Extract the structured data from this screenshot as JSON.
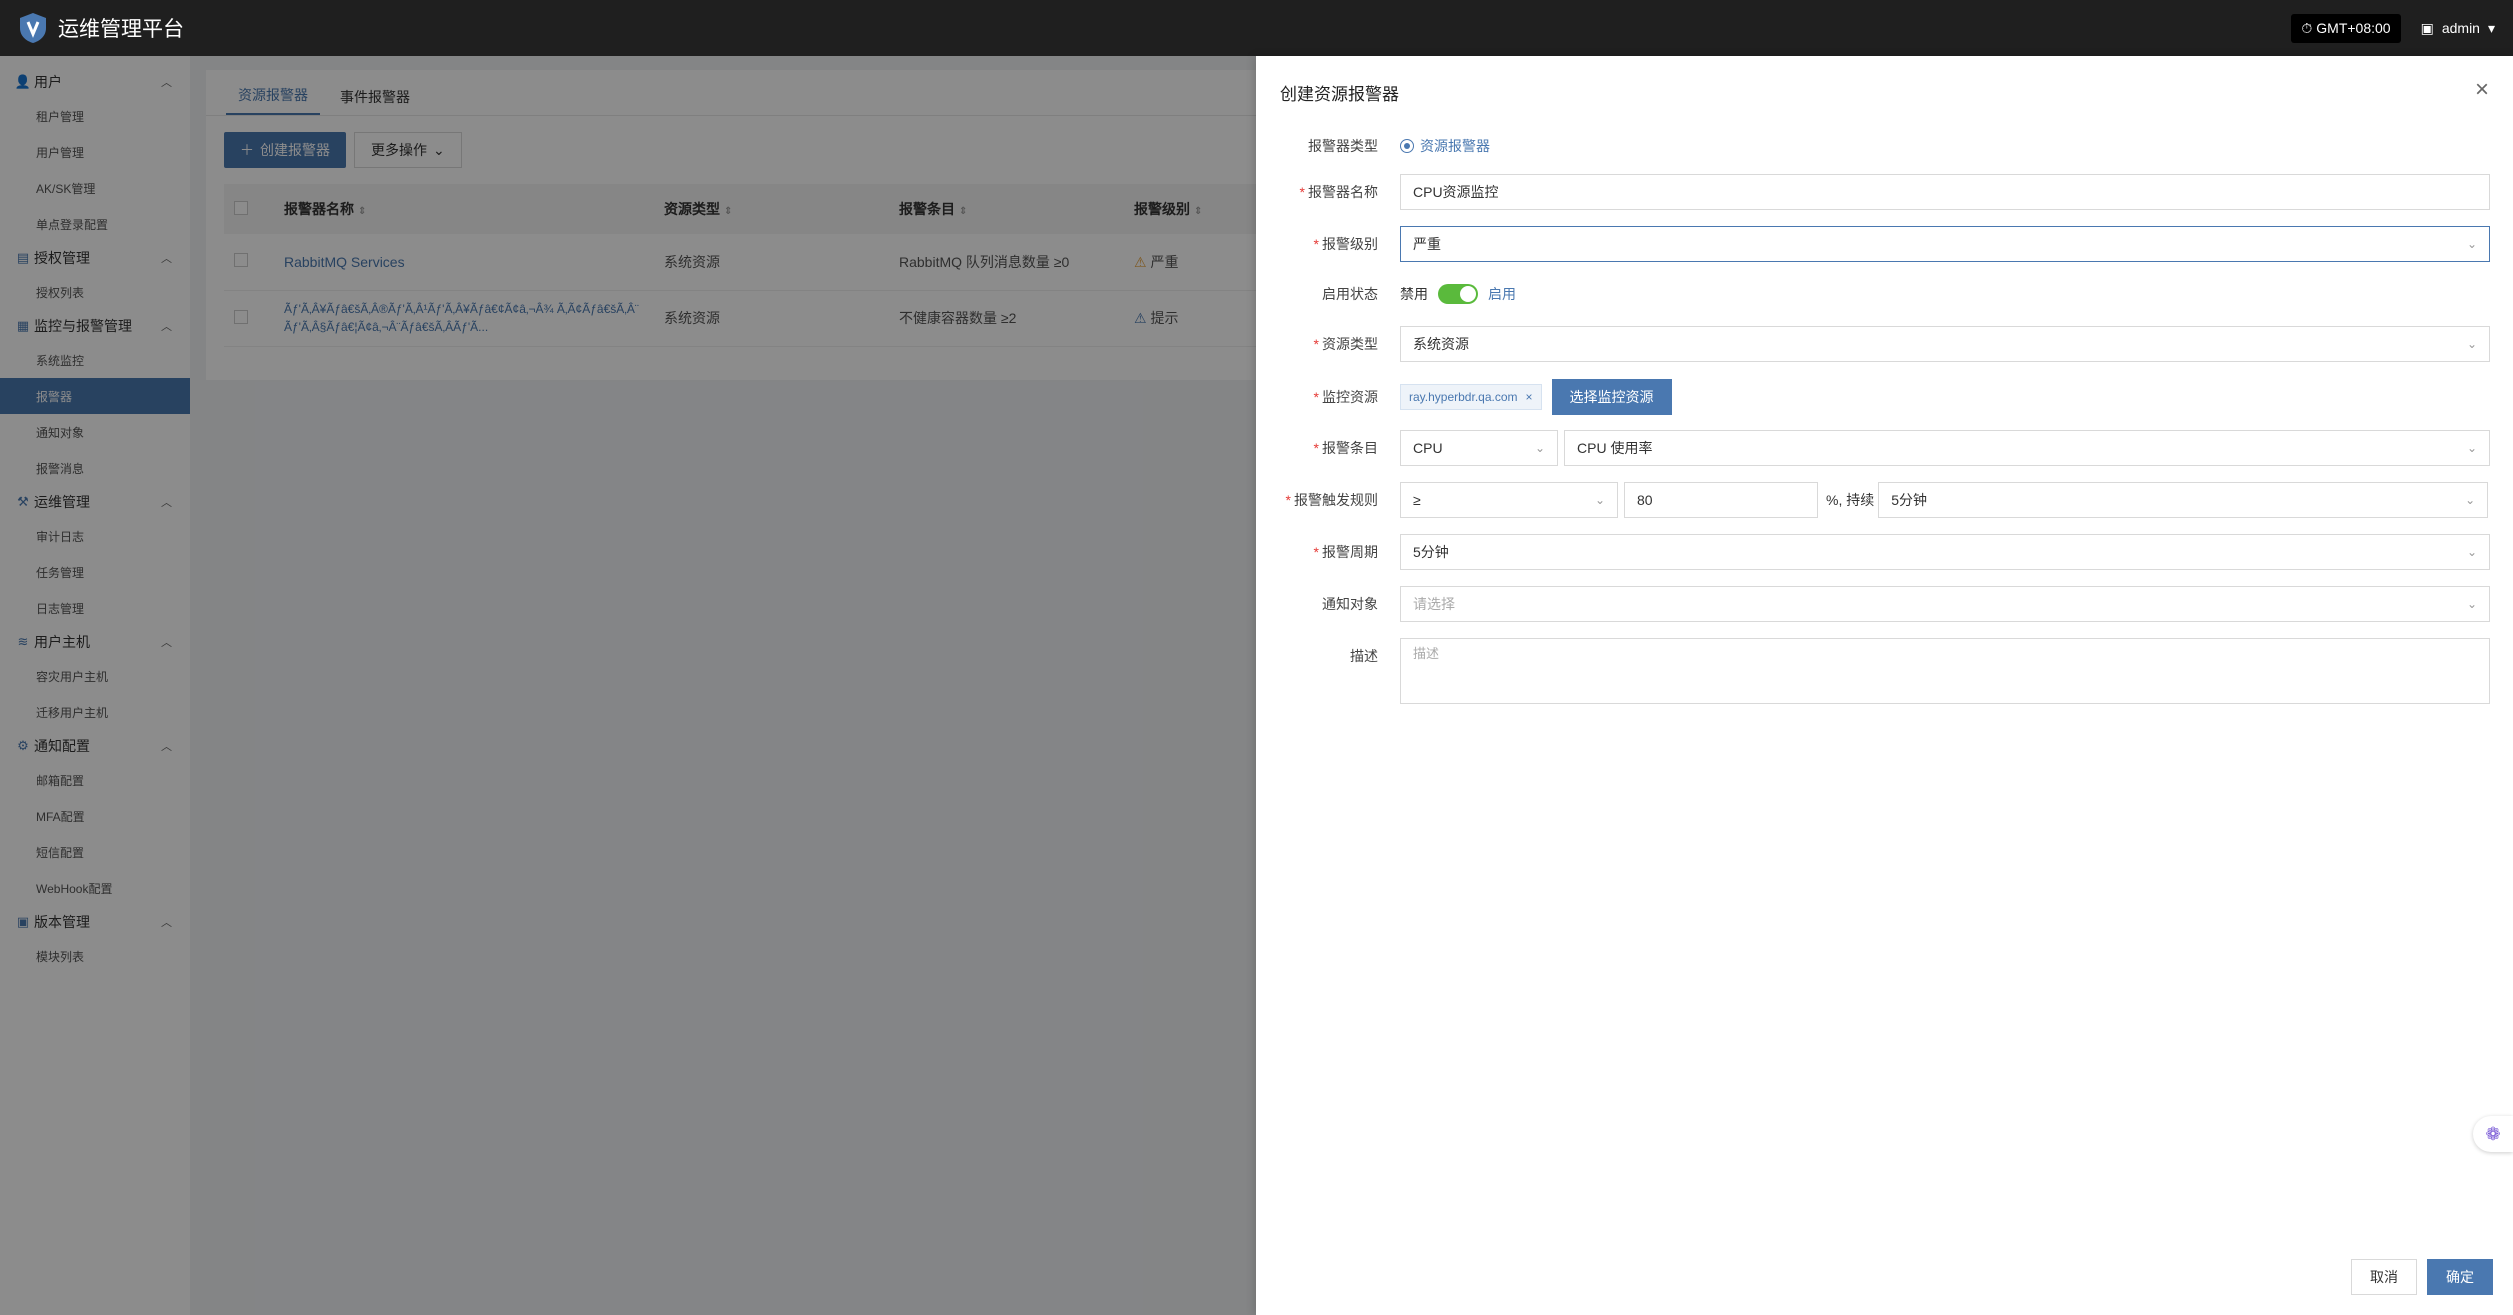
{
  "header": {
    "title": "运维管理平台",
    "timezone": "GMT+08:00",
    "user": "admin"
  },
  "sidebar": {
    "groups": [
      {
        "label": "用户",
        "icon": "user-icon",
        "items": [
          "租户管理",
          "用户管理",
          "AK/SK管理",
          "单点登录配置"
        ]
      },
      {
        "label": "授权管理",
        "icon": "license-icon",
        "items": [
          "授权列表"
        ]
      },
      {
        "label": "监控与报警管理",
        "icon": "monitor-icon",
        "items": [
          "系统监控",
          "报警器",
          "通知对象",
          "报警消息"
        ]
      },
      {
        "label": "运维管理",
        "icon": "tools-icon",
        "items": [
          "审计日志",
          "任务管理",
          "日志管理"
        ]
      },
      {
        "label": "用户主机",
        "icon": "host-icon",
        "items": [
          "容灾用户主机",
          "迁移用户主机"
        ]
      },
      {
        "label": "通知配置",
        "icon": "gear-icon",
        "items": [
          "邮箱配置",
          "MFA配置",
          "短信配置",
          "WebHook配置"
        ]
      },
      {
        "label": "版本管理",
        "icon": "package-icon",
        "items": [
          "模块列表"
        ]
      }
    ],
    "active": "报警器"
  },
  "main": {
    "tabs": [
      "资源报警器",
      "事件报警器"
    ],
    "create_button": "创建报警器",
    "more_button": "更多操作",
    "columns": [
      "报警器名称",
      "资源类型",
      "报警条目",
      "报警级别"
    ],
    "rows": [
      {
        "name": "RabbitMQ Services",
        "type": "系统资源",
        "item": "RabbitMQ 队列消息数量 ≥0",
        "level": "严重"
      },
      {
        "name": "Ãƒ'Ã‚Â¥Ãƒâ€šÃ‚Â®Ãƒ'Ã‚Â¹Ãƒ'Ã‚Â¥Ãƒâ€¢Ã¢â‚¬Â¾ Ã‚Ã¢Ãƒâ€šÃ‚Â¨Ãƒ'Ã‚Â§Ãƒâ€¦Ã¢â‚¬Â¨Ãƒâ€šÃ‚ÂÃƒ'Ã...",
        "type": "系统资源",
        "item": "不健康容器数量 ≥2",
        "level": "提示"
      }
    ]
  },
  "drawer": {
    "title": "创建资源报警器",
    "fields": {
      "type_label": "报警器类型",
      "type_value": "资源报警器",
      "name_label": "报警器名称",
      "name_value": "CPU资源监控",
      "level_label": "报警级别",
      "level_value": "严重",
      "status_label": "启用状态",
      "status_off": "禁用",
      "status_on": "启用",
      "res_type_label": "资源类型",
      "res_type_value": "系统资源",
      "res_label": "监控资源",
      "res_tag": "ray.hyperbdr.qa.com",
      "res_button": "选择监控资源",
      "item_label": "报警条目",
      "item_cat": "CPU",
      "item_value": "CPU 使用率",
      "rule_label": "报警触发规则",
      "rule_op": "≥",
      "rule_val": "80",
      "rule_unit": "%, 持续",
      "rule_dur": "5分钟",
      "period_label": "报警周期",
      "period_value": "5分钟",
      "notify_label": "通知对象",
      "notify_placeholder": "请选择",
      "desc_label": "描述",
      "desc_placeholder": "描述"
    },
    "cancel": "取消",
    "confirm": "确定"
  },
  "colors": {
    "accent": "#4a78b0",
    "switch_on": "#5aba3c",
    "header_bg": "#1f1f1f"
  }
}
